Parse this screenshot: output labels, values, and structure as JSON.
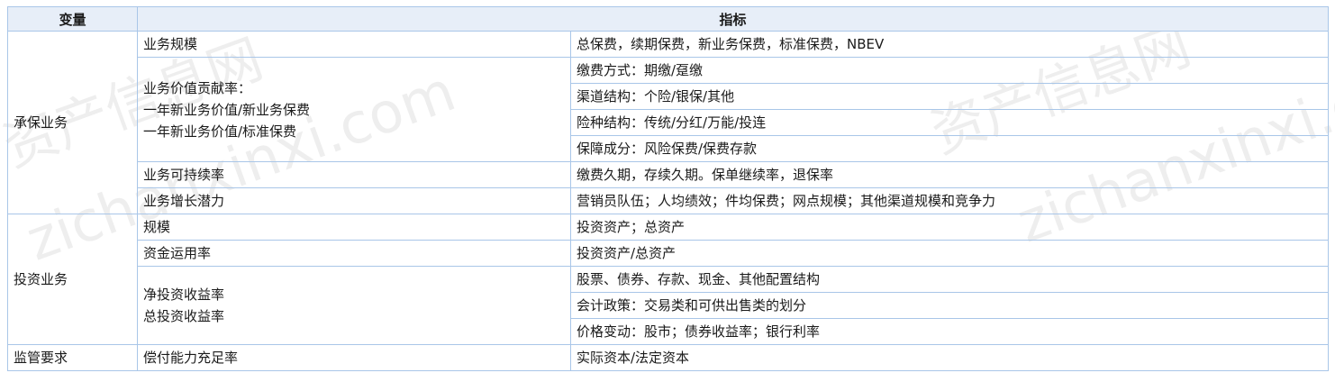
{
  "header": {
    "col1": "变量",
    "col2": "指标"
  },
  "groups": [
    {
      "name": "承保业务",
      "rows": [
        {
          "variable": [
            "业务规模"
          ],
          "indicators": [
            "总保费，续期保费，新业务保费，标准保费，NBEV"
          ]
        },
        {
          "variable": [
            "业务价值贡献率：",
            "一年新业务价值/新业务保费",
            "一年新业务价值/标准保费"
          ],
          "indicators": [
            "缴费方式：期缴/趸缴",
            "渠道结构：个险/银保/其他",
            "险种结构：传统/分红/万能/投连",
            "保障成分：风险保费/保费存款"
          ]
        },
        {
          "variable": [
            "业务可持续率"
          ],
          "indicators": [
            "缴费久期，存续久期。保单继续率，退保率"
          ]
        },
        {
          "variable": [
            "业务增长潜力"
          ],
          "indicators": [
            "营销员队伍；人均绩效；件均保费；网点规模；其他渠道规模和竞争力"
          ]
        }
      ]
    },
    {
      "name": "投资业务",
      "rows": [
        {
          "variable": [
            "规模"
          ],
          "indicators": [
            "投资资产；总资产"
          ]
        },
        {
          "variable": [
            "资金运用率"
          ],
          "indicators": [
            "投资资产/总资产"
          ]
        },
        {
          "variable": [
            "净投资收益率",
            "总投资收益率"
          ],
          "indicators": [
            "股票、债券、存款、现金、其他配置结构",
            "会计政策：交易类和可供出售类的划分",
            "价格变动：股市；债券收益率；银行利率"
          ]
        }
      ]
    },
    {
      "name": "监管要求",
      "rows": [
        {
          "variable": [
            "偿付能力充足率"
          ],
          "indicators": [
            "实际资本/法定资本"
          ]
        }
      ]
    }
  ],
  "watermark": {
    "cn": "资产信息网",
    "en": "zichanxinxi.com"
  }
}
